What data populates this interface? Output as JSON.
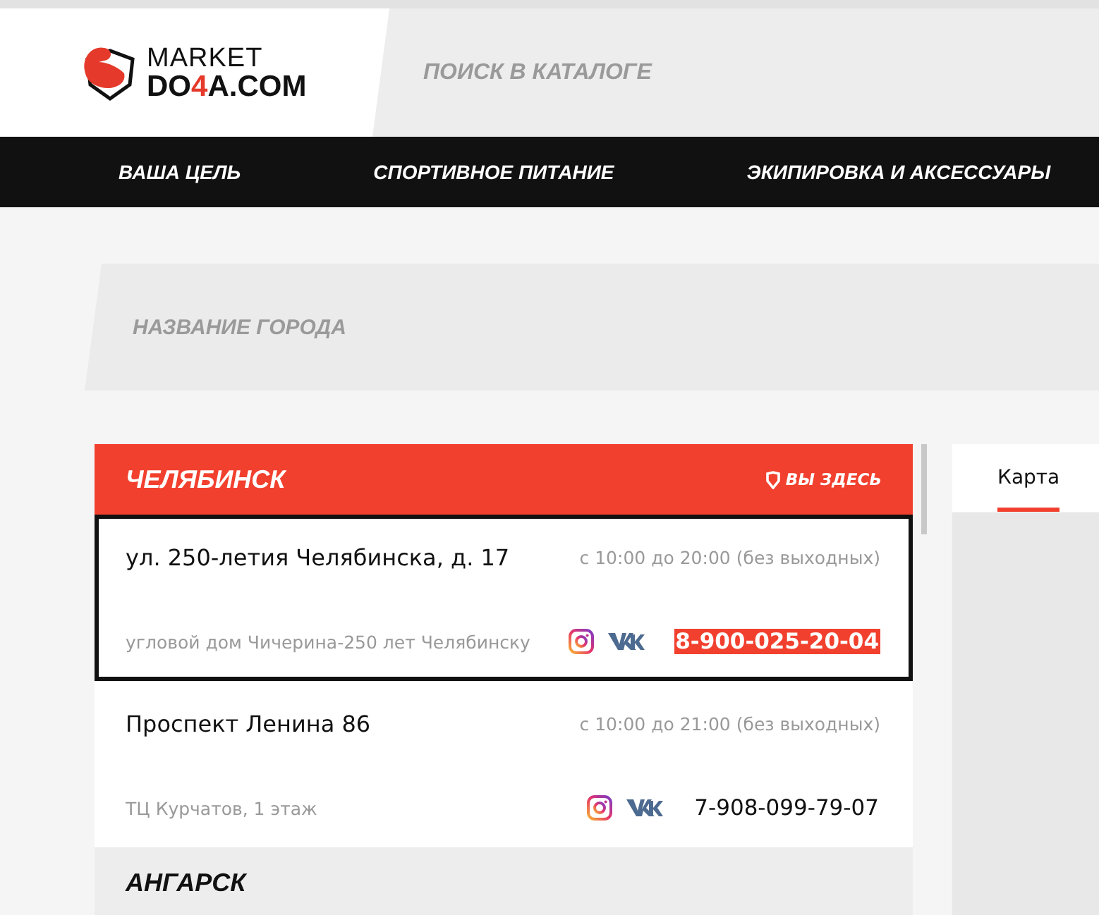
{
  "logo": {
    "line1": "MARKET",
    "line2a": "DO",
    "line2b": "4",
    "line2c": "A.COM"
  },
  "search": {
    "placeholder": "ПОИСК В КАТАЛОГЕ"
  },
  "nav": [
    "ВАША ЦЕЛЬ",
    "СПОРТИВНОЕ ПИТАНИЕ",
    "ЭКИПИРОВКА И АКСЕССУАРЫ"
  ],
  "city_search": {
    "placeholder": "НАЗВАНИЕ ГОРОДА"
  },
  "cities": [
    {
      "name": "ЧЕЛЯБИНСК",
      "current": true,
      "here_label": "ВЫ ЗДЕСЬ",
      "stores": [
        {
          "address": "ул. 250-летия Челябинска, д. 17",
          "hours": "с 10:00 до 20:00 (без выходных)",
          "note": "угловой дом Чичерина-250 лет Челябинску",
          "phone": "8-900-025-20-04",
          "selected": true
        },
        {
          "address": "Проспект Ленина 86",
          "hours": "с 10:00 до 21:00 (без выходных)",
          "note": "ТЦ Курчатов, 1 этаж",
          "phone": "7-908-099-79-07",
          "selected": false
        }
      ]
    },
    {
      "name": "АНГАРСК",
      "current": false
    }
  ],
  "tabs": [
    {
      "label": "Карта",
      "selected": true
    }
  ]
}
